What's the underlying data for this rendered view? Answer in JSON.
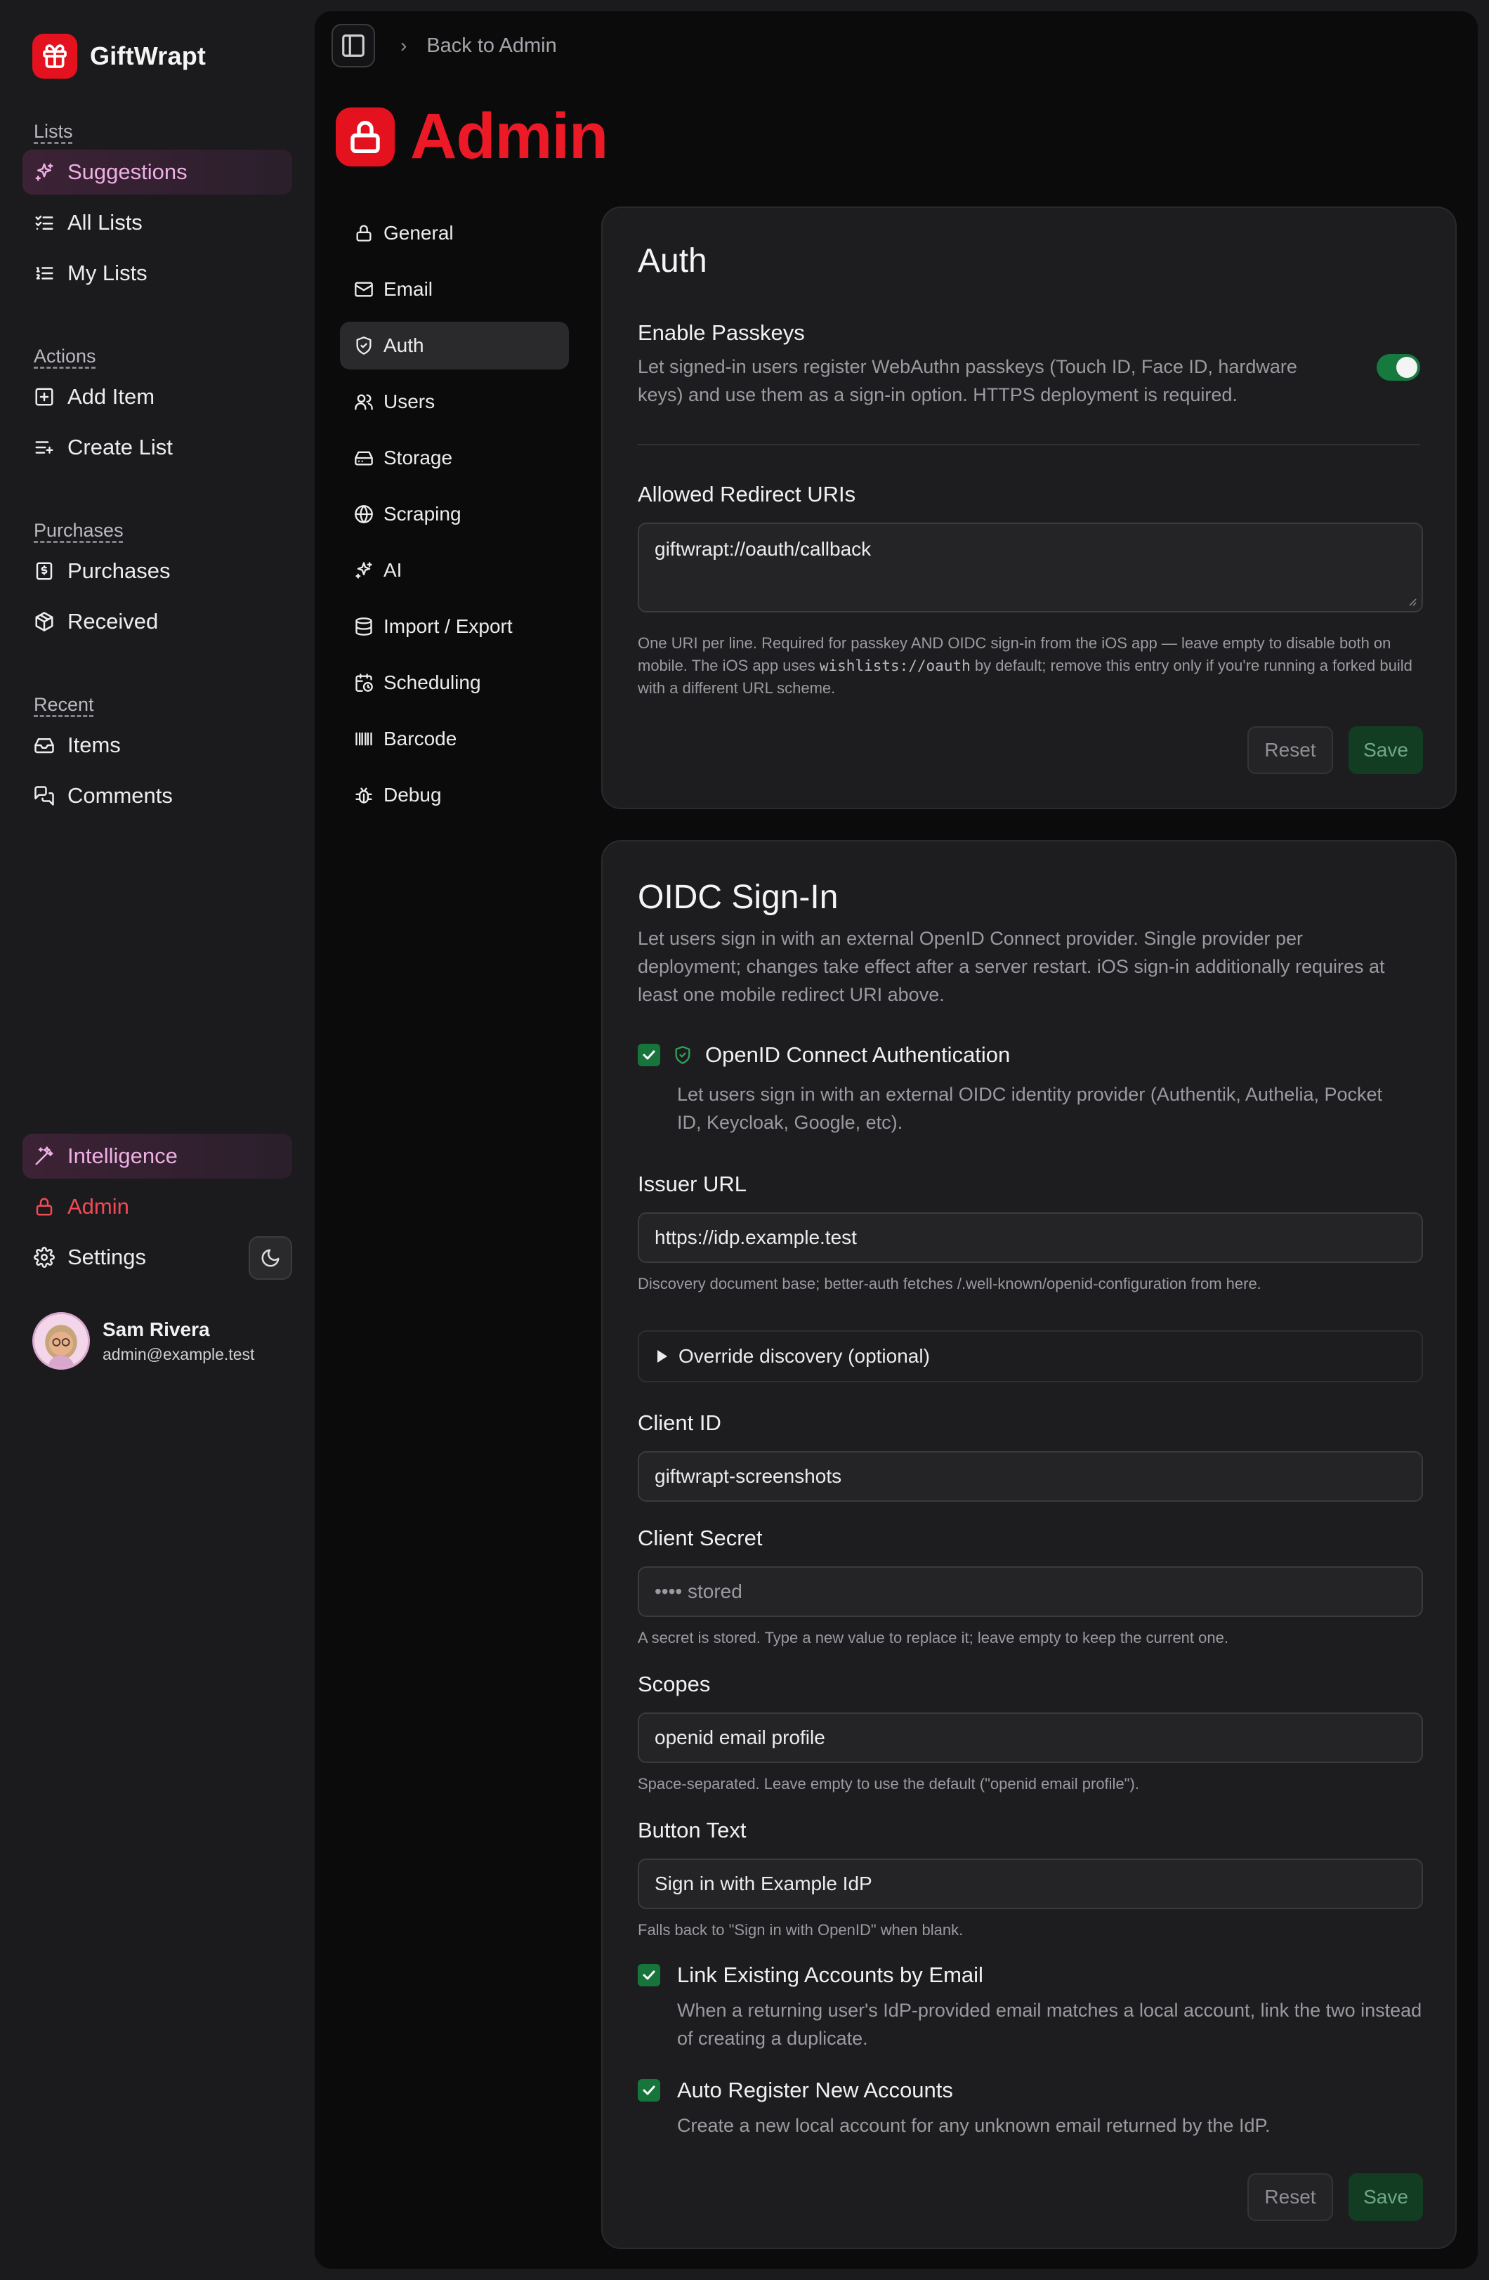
{
  "brand": {
    "name": "GiftWrapt"
  },
  "sidebar": {
    "groups": [
      {
        "label": "Lists",
        "items": [
          {
            "label": "Suggestions",
            "icon": "sparkles-icon"
          },
          {
            "label": "All Lists",
            "icon": "list-checks-icon"
          },
          {
            "label": "My Lists",
            "icon": "list-ordered-icon"
          }
        ]
      },
      {
        "label": "Actions",
        "items": [
          {
            "label": "Add Item",
            "icon": "square-plus-icon"
          },
          {
            "label": "Create List",
            "icon": "list-plus-icon"
          }
        ]
      },
      {
        "label": "Purchases",
        "items": [
          {
            "label": "Purchases",
            "icon": "receipt-icon"
          },
          {
            "label": "Received",
            "icon": "package-icon"
          }
        ]
      },
      {
        "label": "Recent",
        "items": [
          {
            "label": "Items",
            "icon": "inbox-icon"
          },
          {
            "label": "Comments",
            "icon": "messages-icon"
          }
        ]
      }
    ],
    "bottom": {
      "intelligence": "Intelligence",
      "admin": "Admin",
      "settings": "Settings"
    },
    "user": {
      "name": "Sam Rivera",
      "email": "admin@example.test"
    }
  },
  "breadcrumb": {
    "back": "Back to Admin"
  },
  "page": {
    "title": "Admin"
  },
  "subnav": [
    {
      "label": "General",
      "icon": "lock-icon"
    },
    {
      "label": "Email",
      "icon": "mail-icon"
    },
    {
      "label": "Auth",
      "icon": "shield-icon"
    },
    {
      "label": "Users",
      "icon": "users-icon"
    },
    {
      "label": "Storage",
      "icon": "hard-drive-icon"
    },
    {
      "label": "Scraping",
      "icon": "globe-icon"
    },
    {
      "label": "AI",
      "icon": "sparkles-icon"
    },
    {
      "label": "Import / Export",
      "icon": "database-icon"
    },
    {
      "label": "Scheduling",
      "icon": "calendar-clock-icon"
    },
    {
      "label": "Barcode",
      "icon": "barcode-icon"
    },
    {
      "label": "Debug",
      "icon": "bug-icon"
    }
  ],
  "auth": {
    "title": "Auth",
    "passkeys": {
      "label": "Enable Passkeys",
      "description": "Let signed-in users register WebAuthn passkeys (Touch ID, Face ID, hardware keys) and use them as a sign-in option. HTTPS deployment is required.",
      "enabled": true
    },
    "redirect": {
      "label": "Allowed Redirect URIs",
      "value": "giftwrapt://oauth/callback",
      "help_1": "One URI per line. Required for passkey AND OIDC sign-in from the iOS app — leave empty to disable both on mobile. The iOS app uses ",
      "help_code": "wishlists://oauth",
      "help_2": " by default; remove this entry only if you're running a forked build with a different URL scheme."
    },
    "reset": "Reset",
    "save": "Save"
  },
  "oidc": {
    "title": "OIDC Sign-In",
    "intro": "Let users sign in with an external OpenID Connect provider. Single provider per deployment; changes take effect after a server restart. iOS sign-in additionally requires at least one mobile redirect URI above.",
    "enable": {
      "label": "OpenID Connect Authentication",
      "description": "Let users sign in with an external OIDC identity provider (Authentik, Authelia, Pocket ID, Keycloak, Google, etc).",
      "checked": true
    },
    "issuer": {
      "label": "Issuer URL",
      "value": "https://idp.example.test",
      "help": "Discovery document base; better-auth fetches /.well-known/openid-configuration from here."
    },
    "override": "Override discovery (optional)",
    "client_id": {
      "label": "Client ID",
      "value": "giftwrapt-screenshots"
    },
    "client_secret": {
      "label": "Client Secret",
      "placeholder": "•••• stored",
      "help": "A secret is stored. Type a new value to replace it; leave empty to keep the current one."
    },
    "scopes": {
      "label": "Scopes",
      "value": "openid email profile",
      "help": "Space-separated. Leave empty to use the default (\"openid email profile\")."
    },
    "button_text": {
      "label": "Button Text",
      "value": "Sign in with Example IdP",
      "help": "Falls back to \"Sign in with OpenID\" when blank."
    },
    "link_existing": {
      "label": "Link Existing Accounts by Email",
      "description": "When a returning user's IdP-provided email matches a local account, link the two instead of creating a duplicate.",
      "checked": true
    },
    "auto_register": {
      "label": "Auto Register New Accounts",
      "description": "Create a new local account for any unknown email returned by the IdP.",
      "checked": true
    },
    "reset": "Reset",
    "save": "Save"
  },
  "colors": {
    "brand_red": "#e3121e",
    "success_green": "#17753c",
    "suggest_pink": "#eeb0e4"
  }
}
